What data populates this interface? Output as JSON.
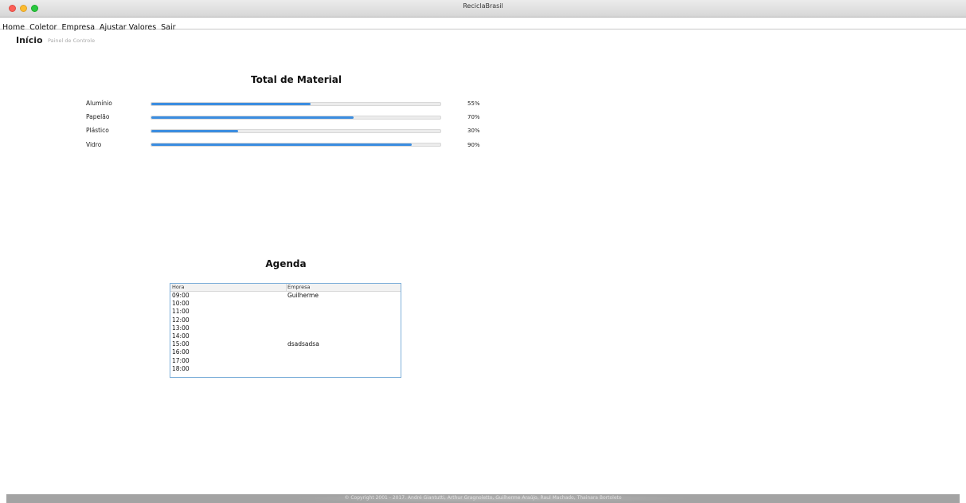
{
  "window": {
    "title": "ReciclaBrasil"
  },
  "menu": [
    "Home",
    "Coletor",
    "Empresa",
    "Ajustar Valores",
    "Sair"
  ],
  "header": {
    "title": "Início",
    "subtitle": "Painel de Controle"
  },
  "materials": {
    "title": "Total de Material",
    "accent_color": "#3b8de0",
    "items": [
      {
        "label": "Alumínio",
        "percent": 55,
        "percent_label": "55%"
      },
      {
        "label": "Papelão",
        "percent": 70,
        "percent_label": "70%"
      },
      {
        "label": "Plástico",
        "percent": 30,
        "percent_label": "30%"
      },
      {
        "label": "Vidro",
        "percent": 90,
        "percent_label": "90%"
      }
    ]
  },
  "agenda": {
    "title": "Agenda",
    "columns": [
      "Hora",
      "Empresa"
    ],
    "rows": [
      {
        "hora": "09:00",
        "empresa": "Guilherme"
      },
      {
        "hora": "10:00",
        "empresa": ""
      },
      {
        "hora": "11:00",
        "empresa": ""
      },
      {
        "hora": "12:00",
        "empresa": ""
      },
      {
        "hora": "13:00",
        "empresa": ""
      },
      {
        "hora": "14:00",
        "empresa": ""
      },
      {
        "hora": "15:00",
        "empresa": "dsadsadsa"
      },
      {
        "hora": "16:00",
        "empresa": ""
      },
      {
        "hora": "17:00",
        "empresa": ""
      },
      {
        "hora": "18:00",
        "empresa": ""
      }
    ]
  },
  "footer": {
    "text": "© Copyright 2001 - 2017. André Giantutti, Arthur Gragnoletto, Guilherme Araújo, Raul Machado, Thainara Bortoleto"
  }
}
